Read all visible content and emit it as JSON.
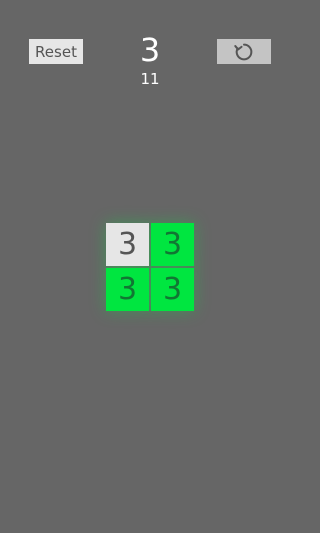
{
  "toolbar": {
    "reset_label": "Reset",
    "restart_icon": "restart-icon"
  },
  "status": {
    "level": "3",
    "moves": "11"
  },
  "board": {
    "tiles": [
      {
        "value": "3",
        "state": "off"
      },
      {
        "value": "3",
        "state": "on"
      },
      {
        "value": "3",
        "state": "on"
      },
      {
        "value": "3",
        "state": "on"
      }
    ]
  },
  "colors": {
    "background": "#666666",
    "tile_on": "#00e640",
    "tile_off": "#e6e6e6"
  }
}
